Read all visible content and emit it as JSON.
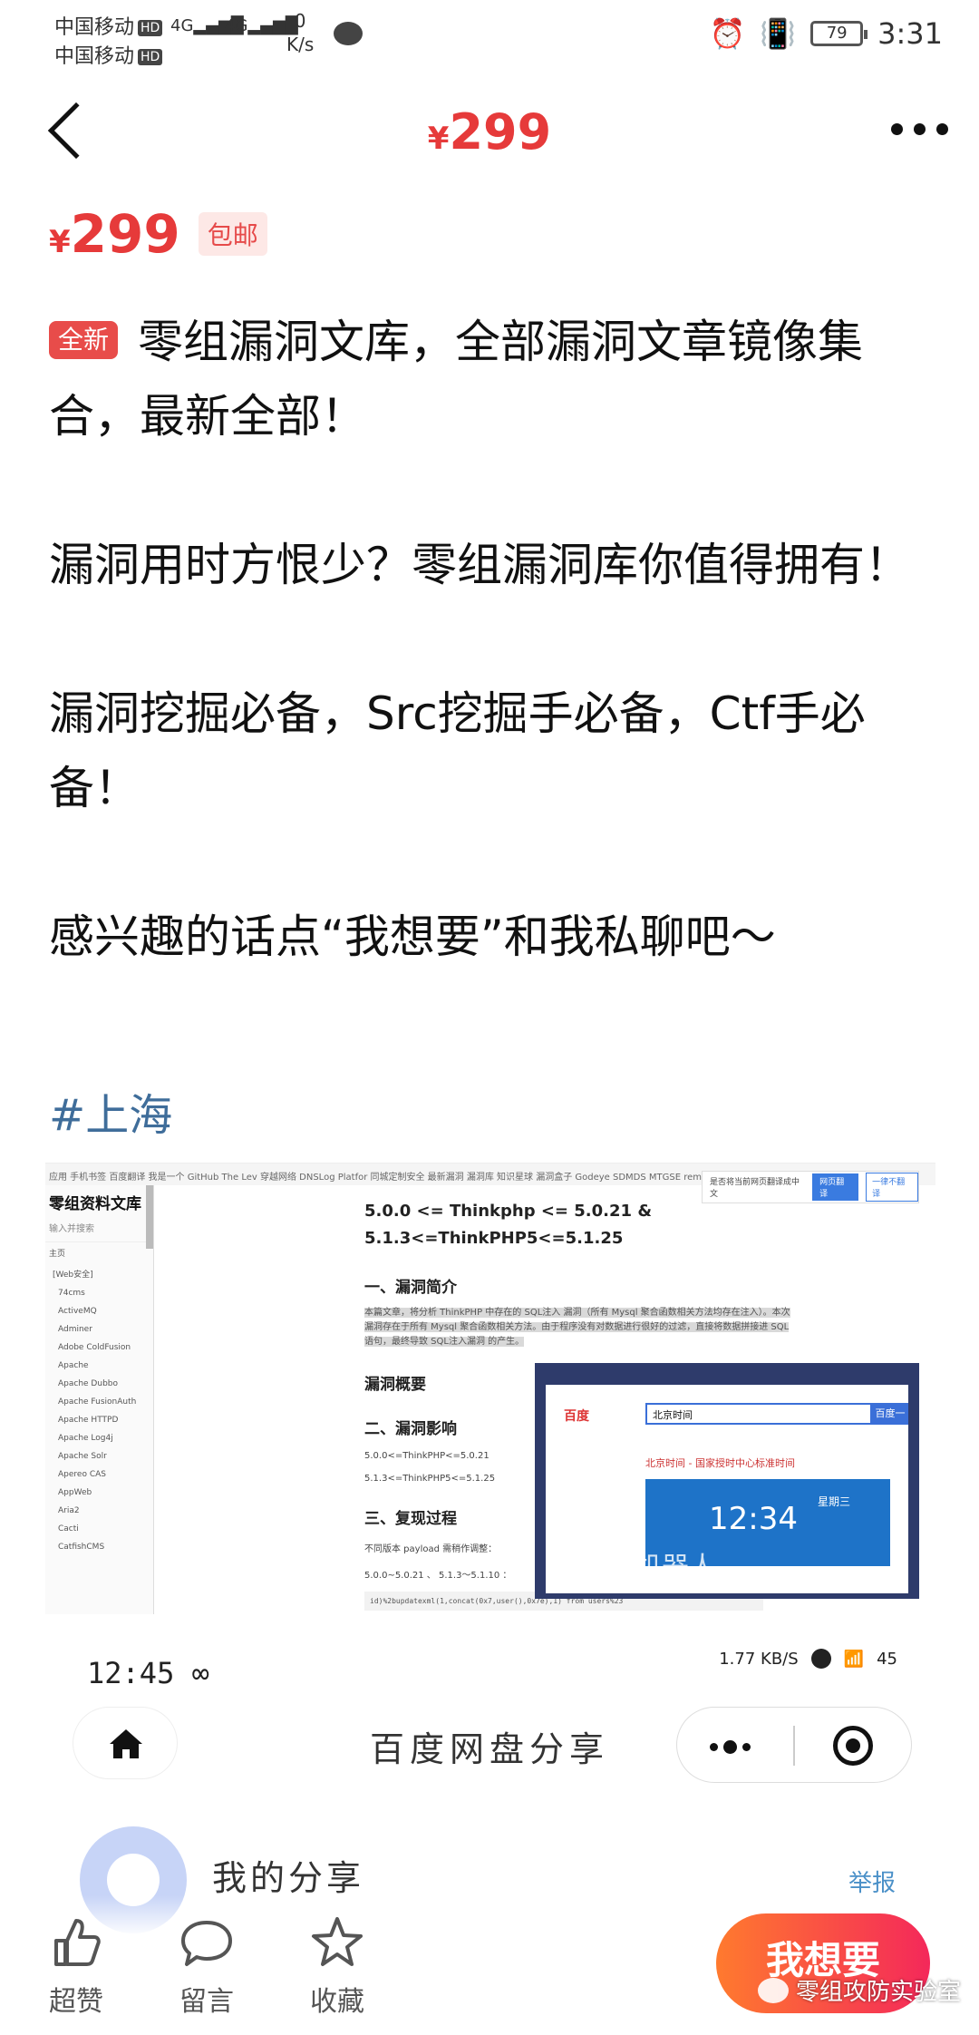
{
  "status_bar": {
    "carrier1": "中国移动",
    "carrier2": "中国移动",
    "hd": "HD",
    "signal": "4G",
    "net_speed_value": "0",
    "net_speed_unit": "K/s",
    "battery": "79",
    "time": "3:31"
  },
  "header": {
    "currency": "¥",
    "price": "299"
  },
  "product": {
    "currency": "¥",
    "price": "299",
    "shipping": "包邮",
    "badge": "全新",
    "title": "零组漏洞文库，全部漏洞文章镜像集合，最新全部！",
    "para1": "漏洞用时方恨少？零组漏洞库你值得拥有！",
    "para2": "漏洞挖掘必备，Src挖掘手必备，Ctf手必备！",
    "para3": "感兴趣的话点“我想要”和我私聊吧～",
    "tag": "#上海"
  },
  "screenshot": {
    "bookmarks": "应用   手机书签   百度翻译   我是一个   GitHub The Lev   穿越网络   DNSLog Platfor   同城定制安全   最新漏洞   漏洞库   知识星球   漏洞盒子   Godeye   SDMDS   MTGSE   remember",
    "sidebar_title": "零组资料文库",
    "sidebar_search": "输入并搜索",
    "sidebar_items": [
      "主页",
      "[Web安全]",
      "74cms",
      "ActiveMQ",
      "Adminer",
      "Adobe ColdFusion",
      "Apache",
      "Apache Dubbo",
      "Apache FusionAuth",
      "Apache HTTPD",
      "Apache Log4j",
      "Apache Solr",
      "Apereo CAS",
      "AppWeb",
      "Aria2",
      "Cacti",
      "CatfishCMS"
    ],
    "translate_prompt": "是否将当前网页翻译成中文",
    "translate_btn": "网页翻译",
    "translate_opt": "一律不翻译",
    "doc_title_1": "5.0.0 <= Thinkphp <= 5.0.21 &",
    "doc_title_2": "5.1.3<=ThinkPHP5<=5.1.25",
    "h_intro": "一、漏洞简介",
    "intro_text": "本篇文章，将分析 ThinkPHP 中存在的 SQL注入 漏洞（所有 Mysql 聚合函数相关方法均存在注入）。本次漏洞存在于所有 Mysql 聚合函数相关方法。由于程序没有对数据进行很好的过滤，直接将数据拼接进 SQL 语句，最终导致 SQL注入漏洞 的产生。",
    "h_overview": "漏洞概要",
    "h_impact": "二、漏洞影响",
    "impact1": "5.0.0<=ThinkPHP<=5.0.21",
    "impact2": "5.1.3<=ThinkPHP5<=5.1.25",
    "h_repro": "三、复现过程",
    "repro_text": "不同版本 payload 需稍作调整：",
    "repro_ver": "5.0.0~5.0.21 、 5.1.3～5.1.10 ：",
    "code": "id)%2bupdatexml(1,concat(0x7,user(),0x7e),1) from users%23",
    "ov_logo": "百度",
    "ov_search": "北京时间",
    "ov_btn": "百度一",
    "ov_link": "北京时间 - 国家授时中心标准时间",
    "ov_time": "12:34",
    "ov_day": "星期三",
    "ov_watermark": "@陀螺机器人"
  },
  "capture": {
    "time": "12:45",
    "net": "1.77 KB/S",
    "battery": "45",
    "title": "百度网盘分享",
    "my_share": "我的分享",
    "report": "举报"
  },
  "bottom": {
    "like": "超赞",
    "comment": "留言",
    "favorite": "收藏",
    "want": "我想要",
    "watermark": "零组攻防实验室"
  }
}
